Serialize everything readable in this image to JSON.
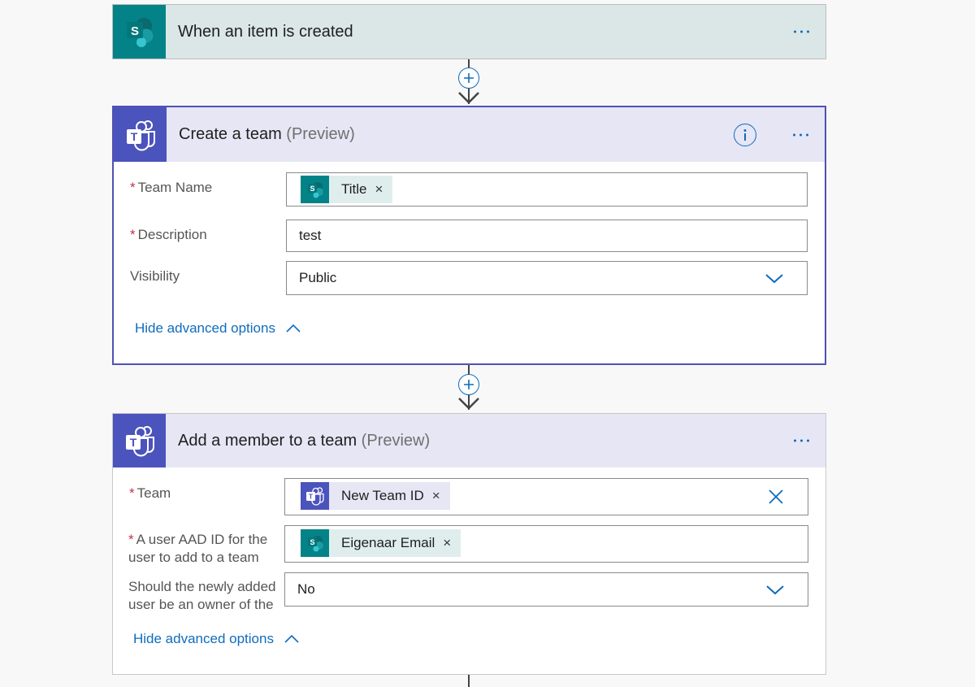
{
  "trigger": {
    "title": "When an item is created",
    "icon": "sharepoint-icon",
    "header_color": "#dae7e6",
    "icon_bg": "#038387"
  },
  "create_team": {
    "title": "Create a team",
    "preview": "(Preview)",
    "icon": "teams-icon",
    "header_color": "#e6e6f5",
    "icon_bg": "#4b53bc",
    "fields": {
      "team_name_label": "Team Name",
      "team_name_token": "Title",
      "description_label": "Description",
      "description_value": "test",
      "visibility_label": "Visibility",
      "visibility_value": "Public"
    },
    "advanced_link": "Hide advanced options"
  },
  "add_member": {
    "title": "Add a member to a team",
    "preview": "(Preview)",
    "icon": "teams-icon",
    "fields": {
      "team_label": "Team",
      "team_token": "New Team ID",
      "user_label_line1": "A user AAD ID for the",
      "user_label_line2": "user to add to a team",
      "user_token": "Eigenaar Email",
      "owner_label_line1": "Should the newly added",
      "owner_label_line2": "user be an owner of the",
      "owner_value": "No"
    },
    "advanced_link": "Hide advanced options"
  },
  "common": {
    "required_mark": "*",
    "token_remove": "×"
  },
  "colors": {
    "accent": "#0f6cbd",
    "selected_border": "#4f52b2"
  }
}
